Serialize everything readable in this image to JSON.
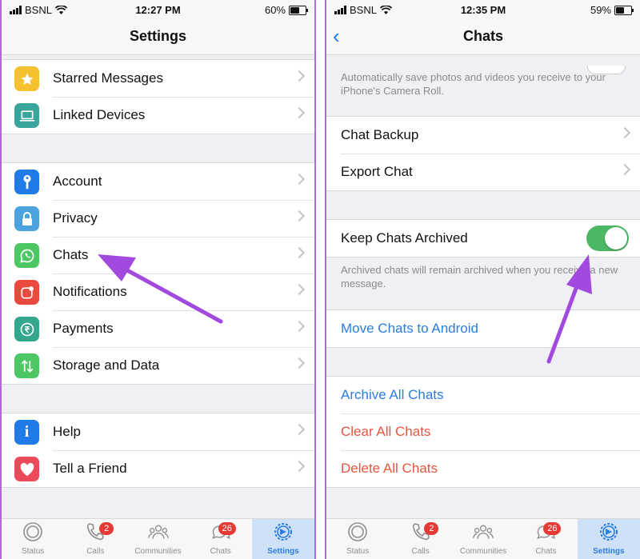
{
  "colors": {
    "accent_blue": "#2a7de1",
    "destructive_red": "#e8543f",
    "toggle_green": "#4cb863",
    "arrow_purple": "#a24ae0",
    "badge_red": "#e53935"
  },
  "left": {
    "status": {
      "carrier": "BSNL",
      "time": "12:27 PM",
      "battery": "60%",
      "battery_level": 0.6
    },
    "title": "Settings",
    "group1": [
      {
        "label": "Starred Messages",
        "icon": "star-icon",
        "color": "#f5c12e"
      },
      {
        "label": "Linked Devices",
        "icon": "laptop-icon",
        "color": "#3aa59b"
      }
    ],
    "group2": [
      {
        "label": "Account",
        "icon": "key-icon",
        "color": "#1e7be8"
      },
      {
        "label": "Privacy",
        "icon": "lock-icon",
        "color": "#4aa3df"
      },
      {
        "label": "Chats",
        "icon": "whatsapp-icon",
        "color": "#4cc764"
      },
      {
        "label": "Notifications",
        "icon": "notification-icon",
        "color": "#ea4a3d"
      },
      {
        "label": "Payments",
        "icon": "rupee-icon",
        "color": "#33a68e"
      },
      {
        "label": "Storage and Data",
        "icon": "arrows-updown-icon",
        "color": "#4cc764"
      }
    ],
    "group3": [
      {
        "label": "Help",
        "icon": "info-icon",
        "color": "#1e7be8"
      },
      {
        "label": "Tell a Friend",
        "icon": "heart-icon",
        "color": "#ea4a5a"
      }
    ],
    "tabs": [
      {
        "label": "Status",
        "badge": ""
      },
      {
        "label": "Calls",
        "badge": "2"
      },
      {
        "label": "Communities",
        "badge": ""
      },
      {
        "label": "Chats",
        "badge": "26"
      },
      {
        "label": "Settings",
        "badge": ""
      }
    ]
  },
  "right": {
    "status": {
      "carrier": "BSNL",
      "time": "12:35 PM",
      "battery": "59%",
      "battery_level": 0.59
    },
    "title": "Chats",
    "top_note": "Automatically save photos and videos you receive to your iPhone's Camera Roll.",
    "backup_rows": [
      "Chat Backup",
      "Export Chat"
    ],
    "keep_archived": {
      "label": "Keep Chats Archived",
      "on": true
    },
    "archived_note": "Archived chats will remain archived when you receive a new message.",
    "move_android": "Move Chats to Android",
    "archive_all": "Archive All Chats",
    "clear_all": "Clear All Chats",
    "delete_all": "Delete All Chats",
    "tabs": [
      {
        "label": "Status",
        "badge": ""
      },
      {
        "label": "Calls",
        "badge": "2"
      },
      {
        "label": "Communities",
        "badge": ""
      },
      {
        "label": "Chats",
        "badge": "26"
      },
      {
        "label": "Settings",
        "badge": ""
      }
    ]
  }
}
